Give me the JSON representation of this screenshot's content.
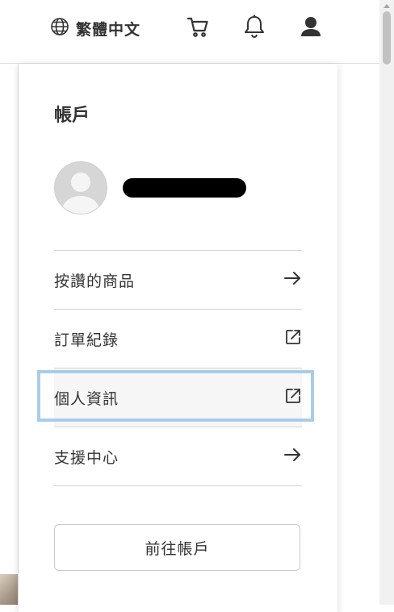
{
  "header": {
    "language_label": "繁體中文",
    "icons": [
      "globe-icon",
      "cart-icon",
      "bell-icon",
      "user-icon"
    ]
  },
  "account_menu": {
    "title": "帳戶",
    "items": [
      {
        "label": "按讚的商品",
        "icon": "arrow-right-icon"
      },
      {
        "label": "訂單紀錄",
        "icon": "external-link-icon"
      },
      {
        "label": "個人資訊",
        "icon": "external-link-icon"
      },
      {
        "label": "支援中心",
        "icon": "arrow-right-icon"
      }
    ],
    "go_to_account_label": "前往帳戶"
  },
  "colors": {
    "focus_ring": "#a9cde9",
    "divider": "#d4d4d4",
    "text": "#333333"
  }
}
